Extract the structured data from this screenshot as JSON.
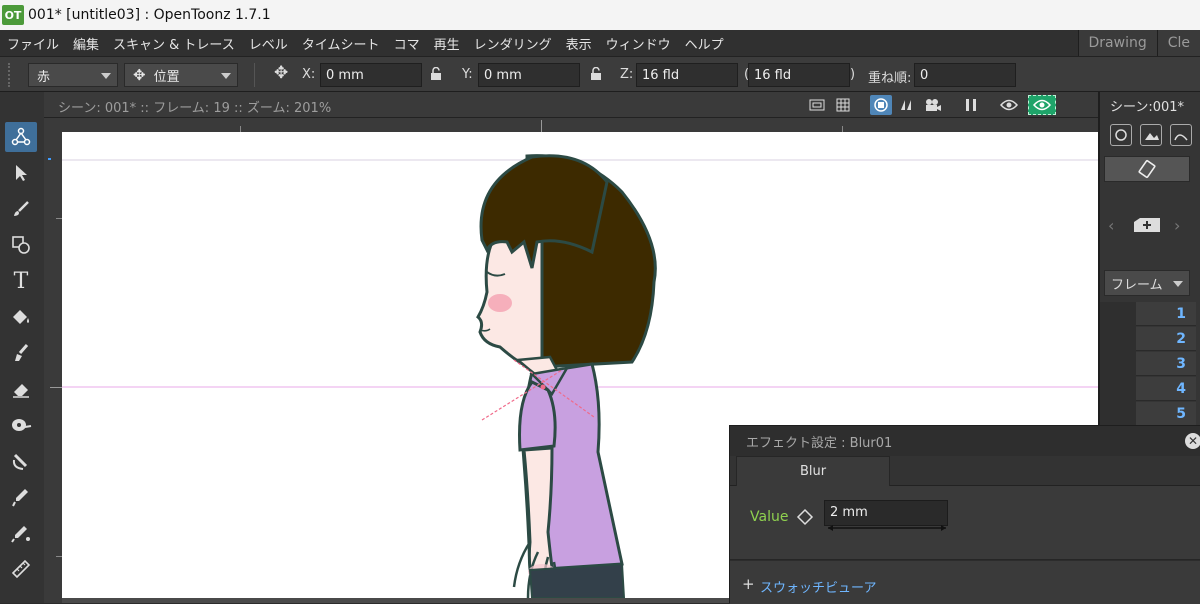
{
  "app": {
    "logo": "OT",
    "title": "001* [untitle03] : OpenToonz 1.7.1"
  },
  "menu": [
    "ファイル",
    "編集",
    "スキャン & トレース",
    "レベル",
    "タイムシート",
    "コマ",
    "再生",
    "レンダリング",
    "表示",
    "ウィンドウ",
    "ヘルプ"
  ],
  "rooms": [
    "Drawing",
    "Cle"
  ],
  "tool_options": {
    "target": "赤",
    "mode": "位置",
    "x_label": "X:",
    "x_value": "0 mm",
    "y_label": "Y:",
    "y_value": "0 mm",
    "z_label": "Z:",
    "z_value": "16 fld",
    "paren_open": "(",
    "z2_value": "16 fld",
    "paren_close": ")",
    "so_label": "重ね順:",
    "so_value": "0"
  },
  "viewer": {
    "info": "シーン: 001*  ::  フレーム: 19  ::  ズーム: 201%"
  },
  "xsheet": {
    "scene": "シーン:001*",
    "frame_label": "フレーム",
    "frames": [
      "1",
      "2",
      "3",
      "4",
      "5"
    ]
  },
  "fx": {
    "title": "エフェクト設定 : Blur01",
    "tab": "Blur",
    "param_label": "Value",
    "param_value": "2 mm",
    "footer": "スウォッチビューア"
  },
  "icons": [
    "animate-tool-icon",
    "selection-tool-icon",
    "brush-tool-icon",
    "geometric-tool-icon",
    "type-tool-icon",
    "fill-tool-icon",
    "paint-brush-tool-icon",
    "eraser-tool-icon",
    "tape-tool-icon",
    "finger-tool-icon",
    "style-picker-tool-icon",
    "rgb-picker-tool-icon",
    "ruler-tool-icon"
  ],
  "colors": {
    "accent": "#3f6f9a",
    "hair": "#3d2a00",
    "shirt": "#c8a0e0",
    "value_label": "#8fd14f",
    "frame_numbers": "#6fb6ff"
  }
}
